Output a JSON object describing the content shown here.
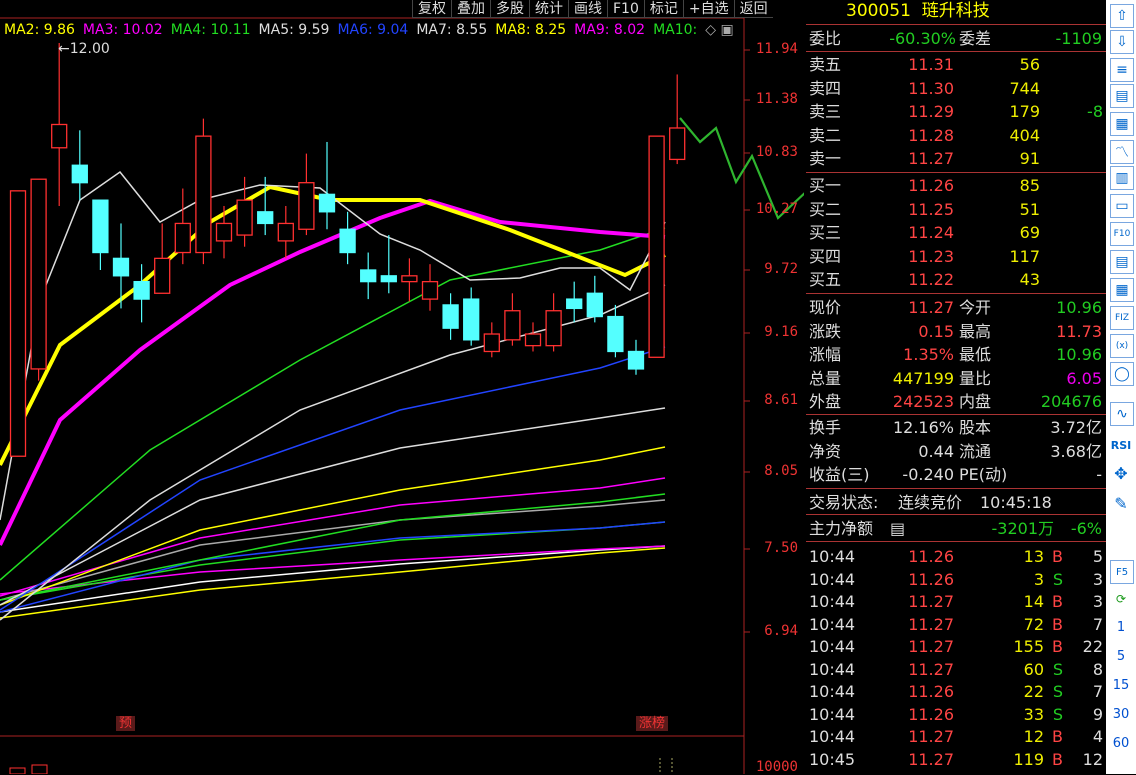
{
  "toolbar": [
    "复权",
    "叠加",
    "多股",
    "统计",
    "画线",
    "F10",
    "标记",
    "+自选",
    "返回"
  ],
  "ma_legend": [
    {
      "label": "MA2: 9.86",
      "color": "#ffff00"
    },
    {
      "label": "MA3: 10.02",
      "color": "#ff00ff"
    },
    {
      "label": "MA4: 10.11",
      "color": "#22dd22"
    },
    {
      "label": "MA5: 9.59",
      "color": "#dddddd"
    },
    {
      "label": "MA6: 9.04",
      "color": "#2244ff"
    },
    {
      "label": "MA7: 8.55",
      "color": "#dddddd"
    },
    {
      "label": "MA8: 8.25",
      "color": "#ffff00"
    },
    {
      "label": "MA9: 8.02",
      "color": "#ff00ff"
    },
    {
      "label": "MA10:",
      "color": "#22dd22"
    }
  ],
  "legend_icons": "◇ ▣",
  "high_marker": "12.00",
  "y_ticks": [
    "11.94",
    "11.38",
    "10.83",
    "10.27",
    "9.72",
    "9.16",
    "8.61",
    "8.05",
    "7.50",
    "6.94",
    "10000"
  ],
  "tags": {
    "pre": "预",
    "limit_up": "涨榜"
  },
  "stock": {
    "code": "300051",
    "name": "琏升科技"
  },
  "wei": {
    "label1": "委比",
    "val1": "-60.30%",
    "label2": "委差",
    "val2": "-1109"
  },
  "asks": [
    {
      "label": "卖五",
      "price": "11.31",
      "vol": "56",
      "chg": ""
    },
    {
      "label": "卖四",
      "price": "11.30",
      "vol": "744",
      "chg": ""
    },
    {
      "label": "卖三",
      "price": "11.29",
      "vol": "179",
      "chg": "-8"
    },
    {
      "label": "卖二",
      "price": "11.28",
      "vol": "404",
      "chg": ""
    },
    {
      "label": "卖一",
      "price": "11.27",
      "vol": "91",
      "chg": ""
    }
  ],
  "bids": [
    {
      "label": "买一",
      "price": "11.26",
      "vol": "85"
    },
    {
      "label": "买二",
      "price": "11.25",
      "vol": "51"
    },
    {
      "label": "买三",
      "price": "11.24",
      "vol": "69"
    },
    {
      "label": "买四",
      "price": "11.23",
      "vol": "117"
    },
    {
      "label": "买五",
      "price": "11.22",
      "vol": "43"
    }
  ],
  "quote": [
    {
      "l1": "现价",
      "v1": "11.27",
      "c1": "red",
      "l2": "今开",
      "v2": "10.96",
      "c2": "green"
    },
    {
      "l1": "涨跌",
      "v1": "0.15",
      "c1": "red",
      "l2": "最高",
      "v2": "11.73",
      "c2": "red"
    },
    {
      "l1": "涨幅",
      "v1": "1.35%",
      "c1": "red",
      "l2": "最低",
      "v2": "10.96",
      "c2": "green"
    },
    {
      "l1": "总量",
      "v1": "447199",
      "c1": "yellow",
      "l2": "量比",
      "v2": "6.05",
      "c2": "mag"
    },
    {
      "l1": "外盘",
      "v1": "242523",
      "c1": "red",
      "l2": "内盘",
      "v2": "204676",
      "c2": "green"
    }
  ],
  "fund": [
    {
      "l1": "换手",
      "v1": "12.16%",
      "l2": "股本",
      "v2": "3.72亿"
    },
    {
      "l1": "净资",
      "v1": "0.44",
      "l2": "流通",
      "v2": "3.68亿"
    },
    {
      "l1": "收益(三)",
      "v1": "-0.240",
      "l2": "PE(动)",
      "v2": "-"
    }
  ],
  "status": {
    "label": "交易状态:",
    "value": "连续竞价",
    "time": "10:45:18"
  },
  "mainflow": {
    "label": "主力净额",
    "value": "-3201万",
    "pct": "-6%"
  },
  "ticks": [
    {
      "t": "10:44",
      "p": "11.26",
      "v": "13",
      "s": "B",
      "n": "5"
    },
    {
      "t": "10:44",
      "p": "11.26",
      "v": "3",
      "s": "S",
      "n": "3"
    },
    {
      "t": "10:44",
      "p": "11.27",
      "v": "14",
      "s": "B",
      "n": "3"
    },
    {
      "t": "10:44",
      "p": "11.27",
      "v": "72",
      "s": "B",
      "n": "7"
    },
    {
      "t": "10:44",
      "p": "11.27",
      "v": "155",
      "s": "B",
      "n": "22"
    },
    {
      "t": "10:44",
      "p": "11.27",
      "v": "60",
      "s": "S",
      "n": "8"
    },
    {
      "t": "10:44",
      "p": "11.26",
      "v": "22",
      "s": "S",
      "n": "7"
    },
    {
      "t": "10:44",
      "p": "11.26",
      "v": "33",
      "s": "S",
      "n": "9"
    },
    {
      "t": "10:44",
      "p": "11.27",
      "v": "12",
      "s": "B",
      "n": "4"
    },
    {
      "t": "10:45",
      "p": "11.27",
      "v": "119",
      "s": "B",
      "n": "12"
    }
  ],
  "sidebar": {
    "icons": [
      "arrow-up-icon",
      "arrow-down-icon",
      "list-icon",
      "bars-icon",
      "table-icon",
      "line-chart-icon",
      "candle-icon",
      "page-icon",
      "f10-icon",
      "doc-icon",
      "grid-icon",
      "fiz-icon",
      "rfx-icon",
      "circle-icon",
      "wave-icon"
    ],
    "labels": [
      "RSI",
      "F5"
    ],
    "numbers": [
      "1",
      "5",
      "15",
      "30",
      "60"
    ]
  },
  "chart_data": {
    "type": "candlestick",
    "ylim": [
      6.94,
      11.94
    ],
    "candles": [
      {
        "o": 8.45,
        "c": 10.73,
        "h": 10.73,
        "l": 8.45
      },
      {
        "o": 9.2,
        "c": 10.83,
        "h": 10.83,
        "l": 9.1
      },
      {
        "o": 11.1,
        "c": 11.3,
        "h": 12.0,
        "l": 10.6
      },
      {
        "o": 10.95,
        "c": 10.8,
        "h": 11.25,
        "l": 10.65
      },
      {
        "o": 10.65,
        "c": 10.2,
        "h": 10.65,
        "l": 10.05
      },
      {
        "o": 10.15,
        "c": 10.0,
        "h": 10.45,
        "l": 9.72
      },
      {
        "o": 9.95,
        "c": 9.8,
        "h": 10.1,
        "l": 9.6
      },
      {
        "o": 9.85,
        "c": 10.15,
        "h": 10.45,
        "l": 9.85
      },
      {
        "o": 10.2,
        "c": 10.45,
        "h": 10.75,
        "l": 10.1
      },
      {
        "o": 10.2,
        "c": 11.2,
        "h": 11.35,
        "l": 10.1
      },
      {
        "o": 10.3,
        "c": 10.45,
        "h": 10.6,
        "l": 10.15
      },
      {
        "o": 10.35,
        "c": 10.65,
        "h": 10.85,
        "l": 10.25
      },
      {
        "o": 10.55,
        "c": 10.45,
        "h": 10.85,
        "l": 10.35
      },
      {
        "o": 10.3,
        "c": 10.45,
        "h": 10.6,
        "l": 10.15
      },
      {
        "o": 10.4,
        "c": 10.8,
        "h": 11.05,
        "l": 10.35
      },
      {
        "o": 10.7,
        "c": 10.55,
        "h": 11.15,
        "l": 10.4
      },
      {
        "o": 10.4,
        "c": 10.2,
        "h": 10.55,
        "l": 10.1
      },
      {
        "o": 10.05,
        "c": 9.95,
        "h": 10.2,
        "l": 9.8
      },
      {
        "o": 10.0,
        "c": 9.95,
        "h": 10.35,
        "l": 9.85
      },
      {
        "o": 9.95,
        "c": 10.0,
        "h": 10.15,
        "l": 9.78
      },
      {
        "o": 9.8,
        "c": 9.95,
        "h": 10.1,
        "l": 9.7
      },
      {
        "o": 9.75,
        "c": 9.55,
        "h": 9.85,
        "l": 9.45
      },
      {
        "o": 9.8,
        "c": 9.45,
        "h": 9.9,
        "l": 9.4
      },
      {
        "o": 9.35,
        "c": 9.5,
        "h": 9.6,
        "l": 9.3
      },
      {
        "o": 9.45,
        "c": 9.7,
        "h": 9.85,
        "l": 9.4
      },
      {
        "o": 9.4,
        "c": 9.5,
        "h": 9.6,
        "l": 9.35
      },
      {
        "o": 9.4,
        "c": 9.7,
        "h": 9.85,
        "l": 9.35
      },
      {
        "o": 9.8,
        "c": 9.72,
        "h": 9.95,
        "l": 9.6
      },
      {
        "o": 9.85,
        "c": 9.65,
        "h": 10.0,
        "l": 9.6
      },
      {
        "o": 9.65,
        "c": 9.35,
        "h": 9.75,
        "l": 9.3
      },
      {
        "o": 9.35,
        "c": 9.2,
        "h": 9.45,
        "l": 9.15
      },
      {
        "o": 9.3,
        "c": 11.2,
        "h": 11.2,
        "l": 9.3
      },
      {
        "o": 11.0,
        "c": 11.27,
        "h": 11.73,
        "l": 10.96
      }
    ]
  }
}
